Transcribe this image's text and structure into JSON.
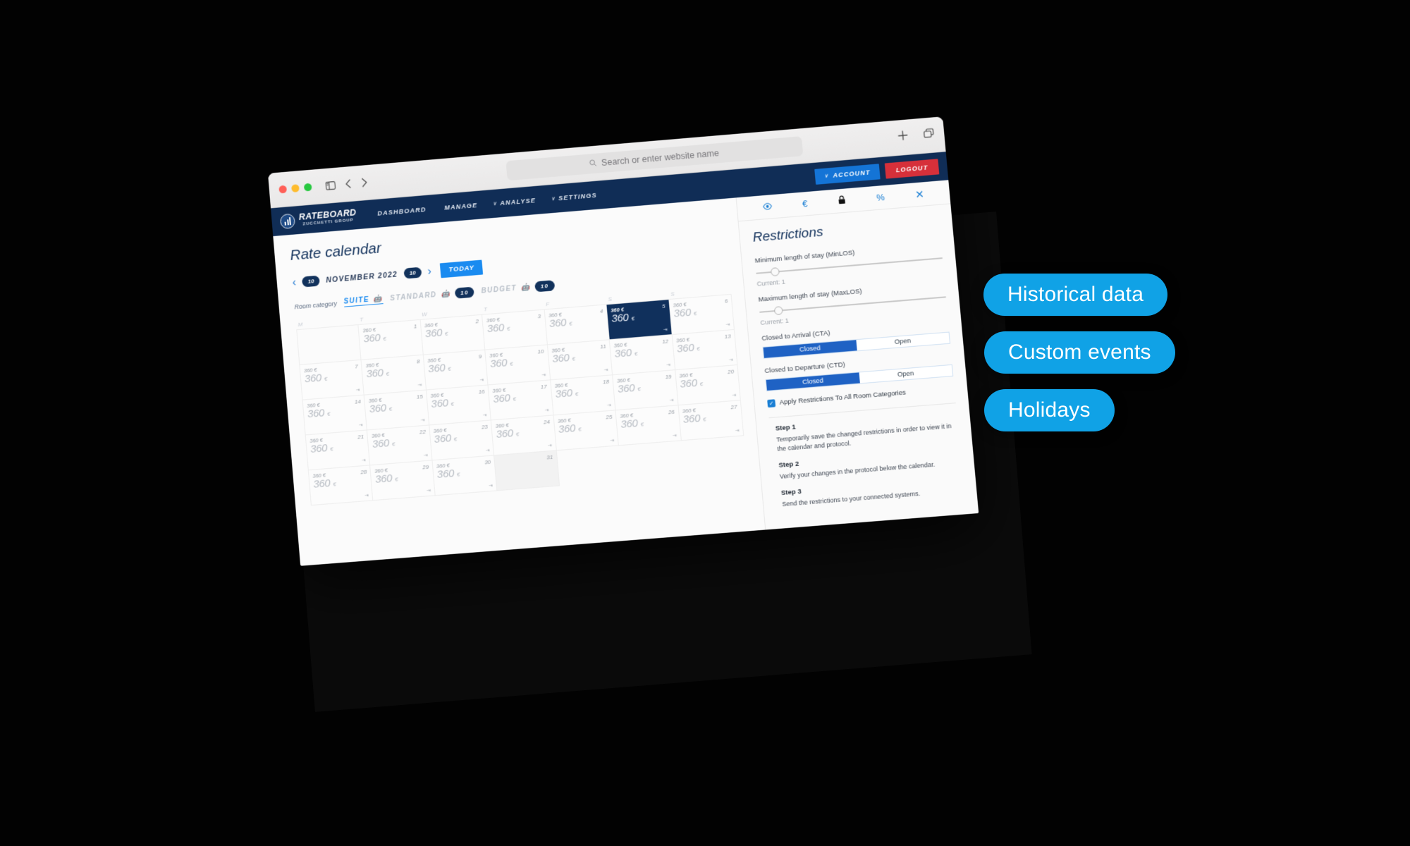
{
  "browser": {
    "search_placeholder": "Search or enter website name",
    "icons": {
      "sidebar": "sidebar-toggle-icon",
      "back": "back-arrow-icon",
      "forward": "forward-arrow-icon",
      "search": "search-icon",
      "new_tab": "plus-icon",
      "tab_overview": "tab-overview-icon"
    },
    "traffic_lights": [
      "close",
      "minimize",
      "maximize"
    ]
  },
  "appnav": {
    "logo_main": "RATEBOARD",
    "logo_sub": "ZUCCHETTI GROUP",
    "links": [
      {
        "label": "DASHBOARD",
        "caret": ""
      },
      {
        "label": "MANAGE",
        "caret": ""
      },
      {
        "label": "ANALYSE",
        "caret": "∨"
      },
      {
        "label": "SETTINGS",
        "caret": "∨"
      }
    ],
    "account_label": "ACCOUNT",
    "account_caret": "∨",
    "logout_label": "LOGOUT",
    "account_color": "#1474d6",
    "logout_color": "#d6303a",
    "bar_color": "#102d56"
  },
  "calendar": {
    "title": "Rate calendar",
    "prev_arrow": "‹",
    "next_arrow": "›",
    "badge_left": "10",
    "badge_right": "10",
    "month_label": "NOVEMBER 2022",
    "today_label": "TODAY",
    "room_category_label": "Room category",
    "room_tabs": [
      {
        "label": "SUITE",
        "active": true,
        "badge": ""
      },
      {
        "label": "STANDARD",
        "active": false,
        "badge": "10"
      },
      {
        "label": "BUDGET",
        "active": false,
        "badge": "10"
      }
    ],
    "weekdays": [
      "M",
      "T",
      "W",
      "T",
      "F",
      "S",
      "S"
    ],
    "leading_blanks": 1,
    "selected_day": 5,
    "days": [
      {
        "day": 1,
        "small": "360 €",
        "price": "360",
        "cur": "€",
        "restr": false
      },
      {
        "day": 2,
        "small": "360 €",
        "price": "360",
        "cur": "€",
        "restr": false
      },
      {
        "day": 3,
        "small": "360 €",
        "price": "360",
        "cur": "€",
        "restr": false
      },
      {
        "day": 4,
        "small": "360 €",
        "price": "360",
        "cur": "€",
        "restr": false
      },
      {
        "day": 5,
        "small": "360 €",
        "price": "360",
        "cur": "€",
        "restr": true
      },
      {
        "day": 6,
        "small": "360 €",
        "price": "360",
        "cur": "€",
        "restr": true
      },
      {
        "day": 7,
        "small": "360 €",
        "price": "360",
        "cur": "€",
        "restr": true
      },
      {
        "day": 8,
        "small": "360 €",
        "price": "360",
        "cur": "€",
        "restr": true
      },
      {
        "day": 9,
        "small": "360 €",
        "price": "360",
        "cur": "€",
        "restr": true
      },
      {
        "day": 10,
        "small": "360 €",
        "price": "360",
        "cur": "€",
        "restr": true
      },
      {
        "day": 11,
        "small": "360 €",
        "price": "360",
        "cur": "€",
        "restr": true
      },
      {
        "day": 12,
        "small": "360 €",
        "price": "360",
        "cur": "€",
        "restr": true
      },
      {
        "day": 13,
        "small": "360 €",
        "price": "360",
        "cur": "€",
        "restr": true
      },
      {
        "day": 14,
        "small": "360 €",
        "price": "360",
        "cur": "€",
        "restr": true
      },
      {
        "day": 15,
        "small": "360 €",
        "price": "360",
        "cur": "€",
        "restr": true
      },
      {
        "day": 16,
        "small": "360 €",
        "price": "360",
        "cur": "€",
        "restr": true
      },
      {
        "day": 17,
        "small": "360 €",
        "price": "360",
        "cur": "€",
        "restr": true
      },
      {
        "day": 18,
        "small": "360 €",
        "price": "360",
        "cur": "€",
        "restr": true
      },
      {
        "day": 19,
        "small": "360 €",
        "price": "360",
        "cur": "€",
        "restr": true
      },
      {
        "day": 20,
        "small": "360 €",
        "price": "360",
        "cur": "€",
        "restr": true
      },
      {
        "day": 21,
        "small": "360 €",
        "price": "360",
        "cur": "€",
        "restr": true
      },
      {
        "day": 22,
        "small": "360 €",
        "price": "360",
        "cur": "€",
        "restr": true
      },
      {
        "day": 23,
        "small": "360 €",
        "price": "360",
        "cur": "€",
        "restr": true
      },
      {
        "day": 24,
        "small": "360 €",
        "price": "360",
        "cur": "€",
        "restr": true
      },
      {
        "day": 25,
        "small": "360 €",
        "price": "360",
        "cur": "€",
        "restr": true
      },
      {
        "day": 26,
        "small": "360 €",
        "price": "360",
        "cur": "€",
        "restr": true
      },
      {
        "day": 27,
        "small": "360 €",
        "price": "360",
        "cur": "€",
        "restr": true
      },
      {
        "day": 28,
        "small": "360 €",
        "price": "360",
        "cur": "€",
        "restr": true
      },
      {
        "day": 29,
        "small": "360 €",
        "price": "360",
        "cur": "€",
        "restr": true
      },
      {
        "day": 30,
        "small": "360 €",
        "price": "360",
        "cur": "€",
        "restr": true
      },
      {
        "day": 31,
        "small": "",
        "price": "",
        "cur": "",
        "restr": false,
        "muted": true
      }
    ]
  },
  "panel": {
    "tabs": [
      {
        "icon": "eye-icon",
        "glyph": "◉",
        "active": false
      },
      {
        "icon": "euro-icon",
        "glyph": "€",
        "active": false
      },
      {
        "icon": "lock-icon",
        "glyph": "🔒",
        "active": true
      },
      {
        "icon": "percent-icon",
        "glyph": "%",
        "active": false
      },
      {
        "icon": "close-icon",
        "glyph": "✕",
        "active": false
      }
    ],
    "title": "Restrictions",
    "minlos_label": "Minimum length of stay (MinLOS)",
    "minlos_current": "Current: 1",
    "maxlos_label": "Maximum length of stay (MaxLOS)",
    "maxlos_current": "Current: 1",
    "cta_label": "Closed to Arrival (CTA)",
    "cta_closed": "Closed",
    "cta_open": "Open",
    "cta_selected": "Closed",
    "ctd_label": "Closed to Departure (CTD)",
    "ctd_closed": "Closed",
    "ctd_open": "Open",
    "ctd_selected": "Closed",
    "apply_all_label": "Apply Restrictions To All Room Categories",
    "apply_all_checked": true,
    "check_glyph": "✓",
    "steps": [
      {
        "title": "Step 1",
        "text": "Temporarily save the changed restrictions in order to view it in the calendar and protocol."
      },
      {
        "title": "Step 2",
        "text": "Verify your changes in the protocol below the calendar."
      },
      {
        "title": "Step 3",
        "text": "Send the restrictions to your connected systems."
      }
    ]
  },
  "callouts": [
    {
      "label": "Historical data"
    },
    {
      "label": "Custom events"
    },
    {
      "label": "Holidays"
    }
  ],
  "colors": {
    "background": "#000000",
    "accent_blue": "#10a2e6",
    "navy": "#102d56",
    "red": "#d6303a"
  }
}
